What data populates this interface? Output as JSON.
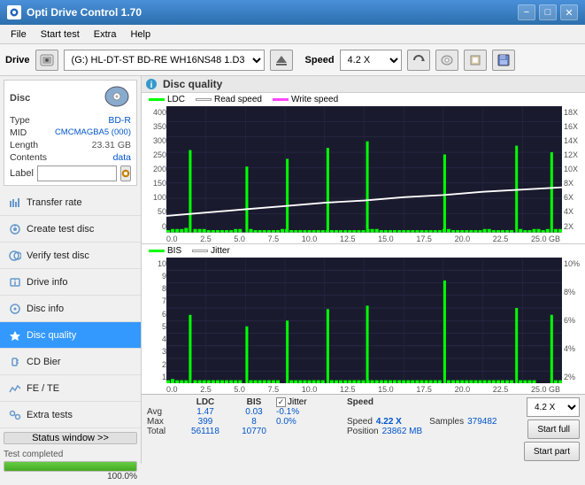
{
  "titleBar": {
    "title": "Opti Drive Control 1.70",
    "minimize": "−",
    "maximize": "□",
    "close": "✕"
  },
  "menuBar": {
    "items": [
      "File",
      "Start test",
      "Extra",
      "Help"
    ]
  },
  "toolbar": {
    "driveLabel": "Drive",
    "driveValue": "(G:) HL-DT-ST BD-RE  WH16NS48 1.D3",
    "speedLabel": "Speed",
    "speedValue": "4.2 X"
  },
  "disc": {
    "typeLabel": "Type",
    "typeValue": "BD-R",
    "midLabel": "MID",
    "midValue": "CMCMAGBA5 (000)",
    "lengthLabel": "Length",
    "lengthValue": "23.31 GB",
    "contentsLabel": "Contents",
    "contentsValue": "data",
    "labelLabel": "Label"
  },
  "nav": {
    "items": [
      {
        "id": "transfer-rate",
        "label": "Transfer rate",
        "icon": "📊"
      },
      {
        "id": "create-test",
        "label": "Create test disc",
        "icon": "💿"
      },
      {
        "id": "verify-test",
        "label": "Verify test disc",
        "icon": "🔍"
      },
      {
        "id": "drive-info",
        "label": "Drive info",
        "icon": "ℹ"
      },
      {
        "id": "disc-info",
        "label": "Disc info",
        "icon": "📀"
      },
      {
        "id": "disc-quality",
        "label": "Disc quality",
        "icon": "⭐",
        "active": true
      },
      {
        "id": "cd-bier",
        "label": "CD Bier",
        "icon": "🍺"
      },
      {
        "id": "fe-te",
        "label": "FE / TE",
        "icon": "📈"
      },
      {
        "id": "extra-tests",
        "label": "Extra tests",
        "icon": "🔬"
      }
    ]
  },
  "statusBtn": "Status window >>",
  "progressBar": {
    "percent": 100,
    "label": "100.0%",
    "statusText": "Test completed"
  },
  "chartSection": {
    "title": "Disc quality",
    "topChart": {
      "legend": [
        {
          "label": "LDC",
          "color": "#00ff00"
        },
        {
          "label": "Read speed",
          "color": "#ffffff"
        },
        {
          "label": "Write speed",
          "color": "#ff44ff"
        }
      ],
      "yLabels": [
        "400",
        "350",
        "300",
        "250",
        "200",
        "150",
        "100",
        "50",
        "0"
      ],
      "yLabelsRight": [
        "18X",
        "16X",
        "14X",
        "12X",
        "10X",
        "8X",
        "6X",
        "4X",
        "2X"
      ],
      "xLabels": [
        "0.0",
        "2.5",
        "5.0",
        "7.5",
        "10.0",
        "12.5",
        "15.0",
        "17.5",
        "20.0",
        "22.5",
        "25.0 GB"
      ]
    },
    "bottomChart": {
      "legend": [
        {
          "label": "BIS",
          "color": "#00ff00"
        },
        {
          "label": "Jitter",
          "color": "#ffffff"
        }
      ],
      "yLabels": [
        "10",
        "9",
        "8",
        "7",
        "6",
        "5",
        "4",
        "3",
        "2",
        "1"
      ],
      "yLabelsRight": [
        "10%",
        "8%",
        "6%",
        "4%",
        "2%"
      ],
      "xLabels": [
        "0.0",
        "2.5",
        "5.0",
        "7.5",
        "10.0",
        "12.5",
        "15.0",
        "17.5",
        "20.0",
        "22.5",
        "25.0 GB"
      ]
    }
  },
  "stats": {
    "headers": [
      "",
      "LDC",
      "BIS",
      "",
      "Jitter",
      "Speed",
      ""
    ],
    "avgRow": {
      "label": "Avg",
      "ldc": "1.47",
      "bis": "0.03",
      "jitter": "-0.1%"
    },
    "maxRow": {
      "label": "Max",
      "ldc": "399",
      "bis": "8",
      "jitter": "0.0%"
    },
    "totalRow": {
      "label": "Total",
      "ldc": "561118",
      "bis": "10770"
    },
    "speedValue": "4.22 X",
    "speedSelect": "4.2 X",
    "positionLabel": "Position",
    "positionValue": "23862 MB",
    "samplesLabel": "Samples",
    "samplesValue": "379482"
  },
  "buttons": {
    "startFull": "Start full",
    "startPart": "Start part"
  }
}
